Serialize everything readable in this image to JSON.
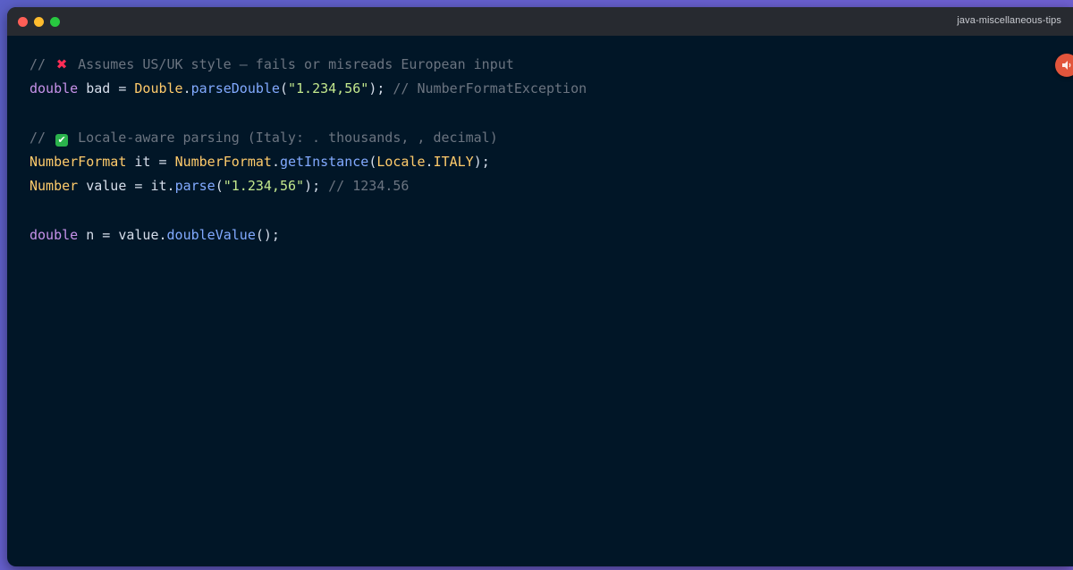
{
  "window": {
    "title": "java-miscellaneous-tips"
  },
  "icons": {
    "x_mark": "✖",
    "check_mark": "✔",
    "close": "close-dot-icon",
    "minimize": "minimize-dot-icon",
    "maximize": "maximize-dot-icon",
    "side_action": "speaker-icon"
  },
  "colors": {
    "background": "#011627",
    "titlebar": "#272a30",
    "comment": "#6b7480",
    "keyword": "#c792ea",
    "class": "#ffcb6b",
    "function": "#82aaff",
    "string": "#c3e88d"
  },
  "code": {
    "line1": {
      "comment_prefix": "// ",
      "comment_text": " Assumes US/UK style — fails or misreads European input"
    },
    "line2": {
      "kw": "double",
      "var": " bad = ",
      "cls": "Double",
      "dot": ".",
      "fn": "parseDouble",
      "open": "(",
      "str": "\"1.234,56\"",
      "close": ");",
      "comment": " // NumberFormatException"
    },
    "line4": {
      "comment_prefix": "// ",
      "comment_text": " Locale-aware parsing (Italy: . thousands, , decimal)"
    },
    "line5": {
      "cls1": "NumberFormat",
      "var": " it = ",
      "cls2": "NumberFormat",
      "dot1": ".",
      "fn": "getInstance",
      "open": "(",
      "cls3": "Locale",
      "dot2": ".",
      "const": "ITALY",
      "close": ");"
    },
    "line6": {
      "cls": "Number",
      "var": " value = it",
      "dot": ".",
      "fn": "parse",
      "open": "(",
      "str": "\"1.234,56\"",
      "close": ");",
      "comment": " // 1234.56"
    },
    "line8": {
      "kw": "double",
      "var": " n = value",
      "dot": ".",
      "fn": "doubleValue",
      "close": "();"
    }
  }
}
